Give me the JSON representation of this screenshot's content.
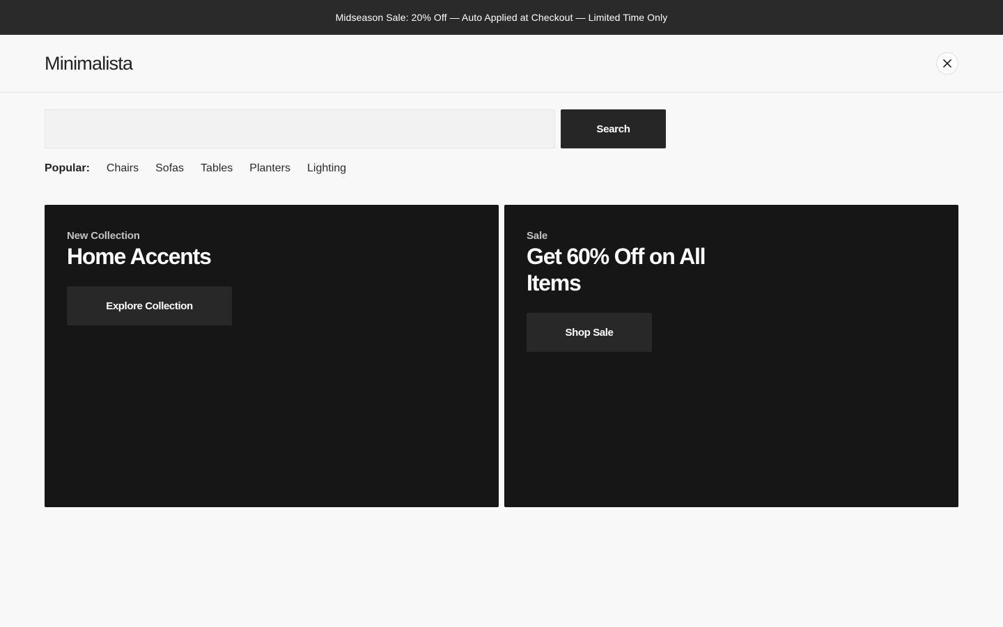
{
  "announcement": {
    "text": "Midseason Sale: 20% Off — Auto Applied at Checkout — Limited Time Only"
  },
  "header": {
    "logo": "Minimalista",
    "close_icon": "close-icon"
  },
  "search": {
    "value": "",
    "placeholder": "",
    "button_label": "Search"
  },
  "popular": {
    "label": "Popular:",
    "links": [
      "Chairs",
      "Sofas",
      "Tables",
      "Planters",
      "Lighting"
    ]
  },
  "cards": [
    {
      "eyebrow": "New Collection",
      "title": "Home Accents",
      "button_label": "Explore Collection"
    },
    {
      "eyebrow": "Sale",
      "title": "Get 60% Off on All Items",
      "button_label": "Shop Sale"
    }
  ],
  "colors": {
    "announcement_bg": "#2a2a2a",
    "page_bg": "#f8f8f8",
    "card_bg": "#161616",
    "button_dark": "#262626"
  }
}
